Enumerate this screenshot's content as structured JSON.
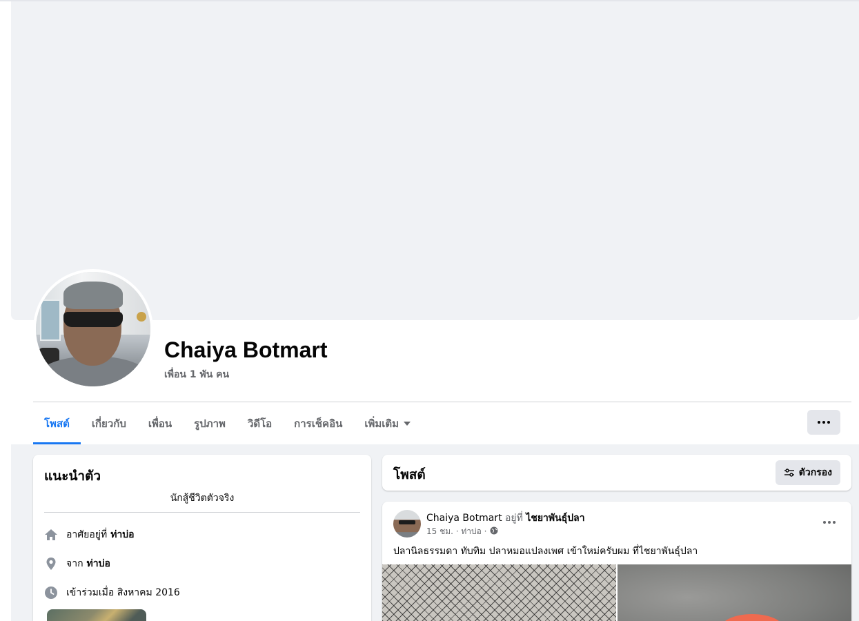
{
  "profile": {
    "name": "Chaiya Botmart",
    "friends": "เพื่อน 1 พัน คน"
  },
  "tabs": [
    {
      "label": "โพสต์",
      "active": true
    },
    {
      "label": "เกี่ยวกับ"
    },
    {
      "label": "เพื่อน"
    },
    {
      "label": "รูปภาพ"
    },
    {
      "label": "วิดีโอ"
    },
    {
      "label": "การเช็คอิน"
    },
    {
      "label": "เพิ่มเติม"
    }
  ],
  "intro": {
    "title": "แนะนำตัว",
    "bio": "นักสู้ชีวิตตัวจริง",
    "lives_prefix": "อาศัยอยู่ที่",
    "lives_place": "ท่าบ่อ",
    "from_prefix": "จาก",
    "from_place": "ท่าบ่อ",
    "joined": "เข้าร่วมเมื่อ สิงหาคม 2016"
  },
  "posts": {
    "title": "โพสต์",
    "filter_label": "ตัวกรอง",
    "items": [
      {
        "author": "Chaiya Botmart",
        "at_text": "อยู่ที่",
        "location": "ไชยาพันธุ์ปลา",
        "meta": "15 ชม. · ท่าบ่อ ·",
        "text": "ปลานิลธรรมดา ทับทิม ปลาหมอแปลงเพศ เข้าใหม่ครับผม ที่ไชยาพันธุ์ปลา"
      }
    ]
  },
  "colors": {
    "accent": "#1877f2",
    "secondary_text": "#65676b",
    "background": "#f0f2f5"
  }
}
